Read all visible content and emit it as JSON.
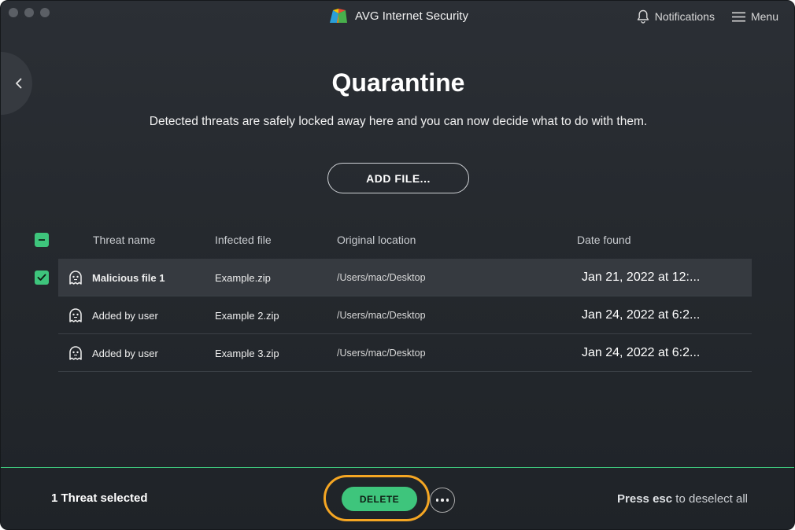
{
  "window": {
    "app_title": "AVG Internet Security"
  },
  "header": {
    "notifications_label": "Notifications",
    "menu_label": "Menu"
  },
  "page": {
    "title": "Quarantine",
    "subtitle": "Detected threats are safely locked away here and you can now decide what to do with them.",
    "add_file_label": "ADD FILE..."
  },
  "table": {
    "columns": [
      "Threat name",
      "Infected file",
      "Original location",
      "Date found"
    ],
    "rows": [
      {
        "name": "Malicious file 1",
        "file": "Example.zip",
        "location": "/Users/mac/Desktop",
        "date": "Jan 21, 2022 at 12:...",
        "checked": true
      },
      {
        "name": "Added by user",
        "file": "Example 2.zip",
        "location": "/Users/mac/Desktop",
        "date": "Jan 24, 2022 at 6:2...",
        "checked": false
      },
      {
        "name": "Added by user",
        "file": "Example 3.zip",
        "location": "/Users/mac/Desktop",
        "date": "Jan 24, 2022 at 6:2...",
        "checked": false
      }
    ]
  },
  "footer": {
    "selected_count": "1 Threat selected",
    "delete_label": "DELETE",
    "esc_hint_bold": "Press esc",
    "esc_hint_rest": " to deselect all"
  },
  "colors": {
    "accent": "#3ec57c",
    "highlight": "#f5a623",
    "background": "#25292e"
  },
  "icons": [
    "bell-icon",
    "hamburger-menu-icon",
    "chevron-left-icon",
    "ghost-icon",
    "checkmark-icon",
    "minus-icon",
    "more-dots-icon",
    "avg-logo"
  ]
}
